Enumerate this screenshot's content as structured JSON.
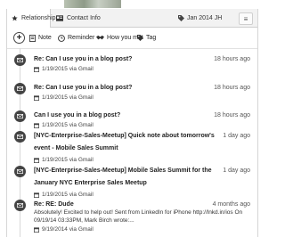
{
  "tabs": {
    "relationship": "Relationship",
    "contact_info": "Contact Info"
  },
  "tag_label": "Jan 2014 JH",
  "menu_glyph": "≡",
  "actions": {
    "add": "+",
    "note": "Note",
    "reminder": "Reminder",
    "how_met": "How you met",
    "tag": "Tag"
  },
  "items": [
    {
      "subject": "Re: Can I use you in a blog post?",
      "time": "18 hours ago",
      "meta": "1/19/2015 via Gmail"
    },
    {
      "subject": "Re: Can I use you in a blog post?",
      "time": "18 hours ago",
      "meta": "1/19/2015 via Gmail"
    },
    {
      "subject": "Can I use you in a blog post?",
      "time": "18 hours ago",
      "meta": "1/19/2015 via Gmail"
    },
    {
      "subject": "[NYC-Enterprise-Sales-Meetup] Quick note about tomorrow's event - Mobile Sales Summit",
      "time": "1 day ago",
      "meta": "1/19/2015 via Gmail"
    },
    {
      "subject": "[NYC-Enterprise-Sales-Meetup] Mobile Sales Summit for the January NYC Enterprise Sales Meetup",
      "time": "1 day ago",
      "meta": "1/19/2015 via Gmail"
    },
    {
      "subject": "Re: RE: Dude",
      "time": "4 months ago",
      "body": "Absolutely! Excited to help out! Sent from LinkedIn for iPhone http://lnkd.in/ios On 09/19/14 03:33PM, Mark Birch wrote:...",
      "meta": "9/19/2014 via Gmail"
    }
  ],
  "colors": {
    "icon_dark": "#444444",
    "tab_bg": "#f2f2f2",
    "border": "#cfcfcf"
  }
}
